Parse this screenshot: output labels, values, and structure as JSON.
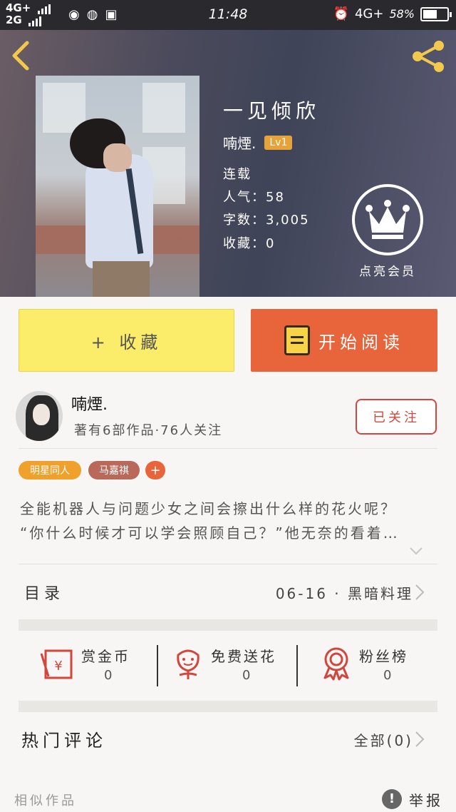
{
  "status_bar": {
    "network_top": "4G+",
    "network_bottom": "2G",
    "time": "11:48",
    "network_right": "4G+",
    "battery": "58%",
    "battery_level": 0.58
  },
  "header": {
    "back_icon": "chevron-left-icon",
    "share_icon": "share-icon"
  },
  "book": {
    "title": "一见倾欣",
    "author": "喃煙.",
    "level": "Lv1",
    "status": "连载",
    "popularity": "人气：58",
    "word_count": "字数：3,005",
    "favorites": "收藏：0",
    "vip_label": "点亮会员"
  },
  "actions": {
    "collect": "+ 收藏",
    "read": "开始阅读"
  },
  "author_section": {
    "name": "喃煙.",
    "meta": "著有6部作品·76人关注",
    "follow": "已关注"
  },
  "tags": [
    "明星同人",
    "马嘉祺",
    "+"
  ],
  "summary": {
    "line1": "全能机器人与问题少女之间会擦出什么样的花火呢？",
    "line2": "“你什么时候才可以学会照顾自己？”他无奈的看着…"
  },
  "catalog": {
    "label": "目录",
    "latest": "06-16 · 黑暗料理"
  },
  "rewards": [
    {
      "label": "赏金币",
      "count": "0",
      "icon": "red-envelope-icon"
    },
    {
      "label": "免费送花",
      "count": "0",
      "icon": "flower-icon"
    },
    {
      "label": "粉丝榜",
      "count": "0",
      "icon": "medal-icon"
    }
  ],
  "comments": {
    "label": "热门评论",
    "all": "全部(0)"
  },
  "footer": {
    "similar": "相似作品",
    "report": "举报",
    "report_icon_glyph": "!"
  },
  "colors": {
    "accent_orange": "#e8643a",
    "collect_yellow": "#fbec6a",
    "follow_red": "#d2473d",
    "level_badge": "#e8a23a"
  }
}
